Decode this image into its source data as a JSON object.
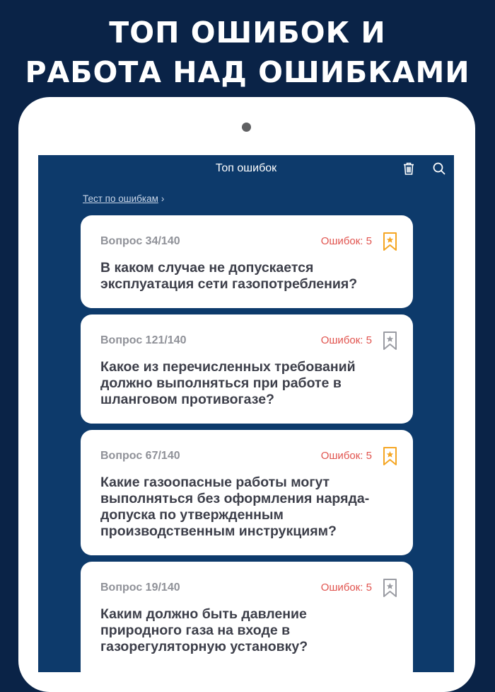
{
  "promo": {
    "line1": "ТОП ОШИБОК И",
    "line2": "РАБОТА НАД ОШИБКАМИ"
  },
  "nav": {
    "title": "Топ ошибок",
    "trash_icon": "trash-icon",
    "search_icon": "search-icon"
  },
  "retest": {
    "label": "Тест по ошибкам",
    "chevron": "›"
  },
  "colors": {
    "background": "#0a2347",
    "screen": "#0d3a6b",
    "error_text": "#e1544f",
    "bookmark_active": "#f5a623",
    "bookmark_inactive": "#9a9ca3"
  },
  "cards": [
    {
      "number": "Вопрос 34/140",
      "errors": "Ошибок: 5",
      "bookmarked": true,
      "question": "В каком случае не допускается эксплуатация сети газопотребления?"
    },
    {
      "number": "Вопрос 121/140",
      "errors": "Ошибок: 5",
      "bookmarked": false,
      "question": "Какое из перечисленных требований должно выполняться при работе в шланговом противогазе?"
    },
    {
      "number": "Вопрос 67/140",
      "errors": "Ошибок: 5",
      "bookmarked": true,
      "question": "Какие газоопасные работы могут выполняться без оформления наряда-допуска по утвержденным производственным инструкциям?"
    },
    {
      "number": "Вопрос 19/140",
      "errors": "Ошибок: 5",
      "bookmarked": false,
      "question": "Каким должно быть давление природного газа на входе в газорегуляторную установку?"
    }
  ]
}
